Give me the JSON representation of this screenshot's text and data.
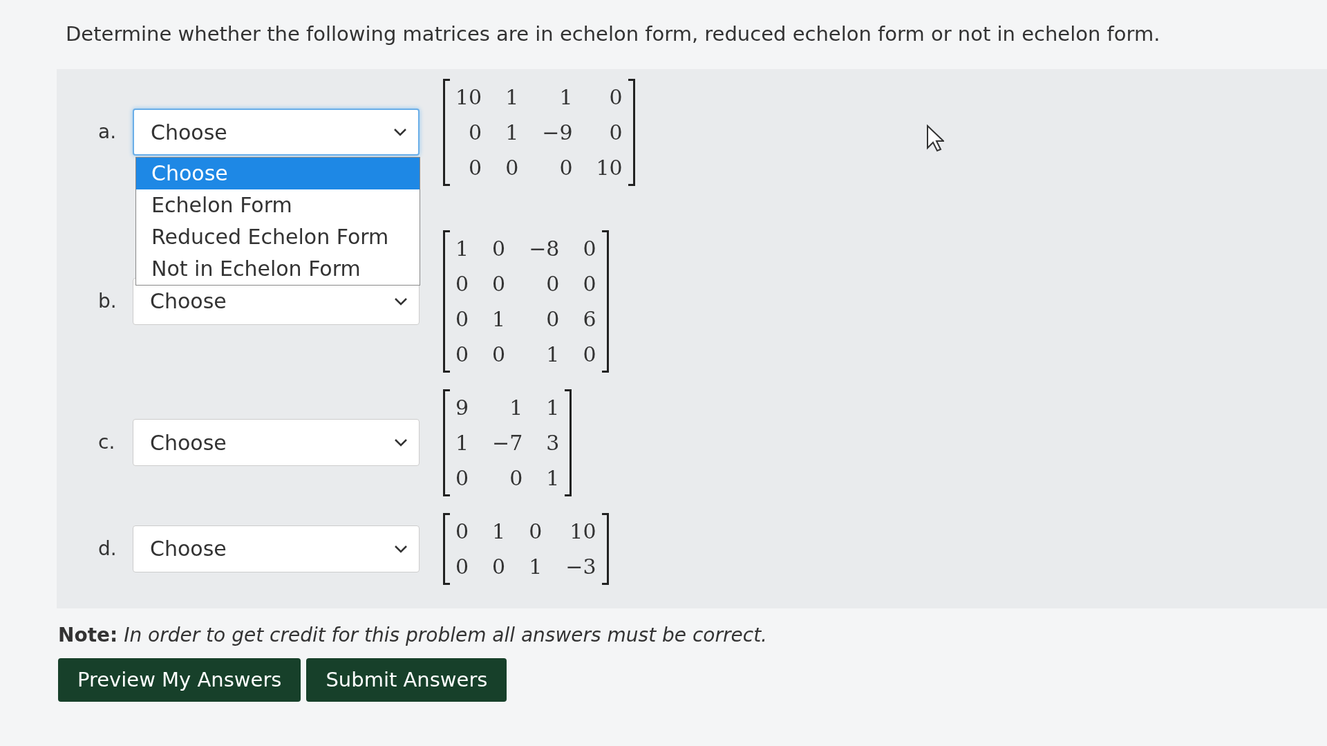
{
  "question": "Determine whether the following matrices are in echelon form, reduced echelon form or not in echelon form.",
  "parts": [
    {
      "label": "a.",
      "value": "Choose",
      "expanded": true,
      "options": [
        {
          "label": "Choose",
          "selected": true
        },
        {
          "label": "Echelon Form",
          "selected": false
        },
        {
          "label": "Reduced Echelon Form",
          "selected": false
        },
        {
          "label": "Not in Echelon Form",
          "selected": false
        }
      ],
      "matrix": [
        [
          "10",
          "1",
          "1",
          "0"
        ],
        [
          "0",
          "1",
          "−9",
          "0"
        ],
        [
          "0",
          "0",
          "0",
          "10"
        ]
      ]
    },
    {
      "label": "b.",
      "value": "Choose",
      "expanded": false,
      "matrix": [
        [
          "1",
          "0",
          "−8",
          "0"
        ],
        [
          "0",
          "0",
          "0",
          "0"
        ],
        [
          "0",
          "1",
          "0",
          "6"
        ],
        [
          "0",
          "0",
          "1",
          "0"
        ]
      ]
    },
    {
      "label": "c.",
      "value": "Choose",
      "expanded": false,
      "matrix": [
        [
          "9",
          "1",
          "1"
        ],
        [
          "1",
          "−7",
          "3"
        ],
        [
          "0",
          "0",
          "1"
        ]
      ]
    },
    {
      "label": "d.",
      "value": "Choose",
      "expanded": false,
      "matrix": [
        [
          "0",
          "1",
          "0",
          "10"
        ],
        [
          "0",
          "0",
          "1",
          "−3"
        ]
      ]
    }
  ],
  "note": {
    "label": "Note:",
    "text": "In order to get credit for this problem all answers must be correct."
  },
  "buttons": [
    "Preview My Answers",
    "Submit Answers"
  ]
}
